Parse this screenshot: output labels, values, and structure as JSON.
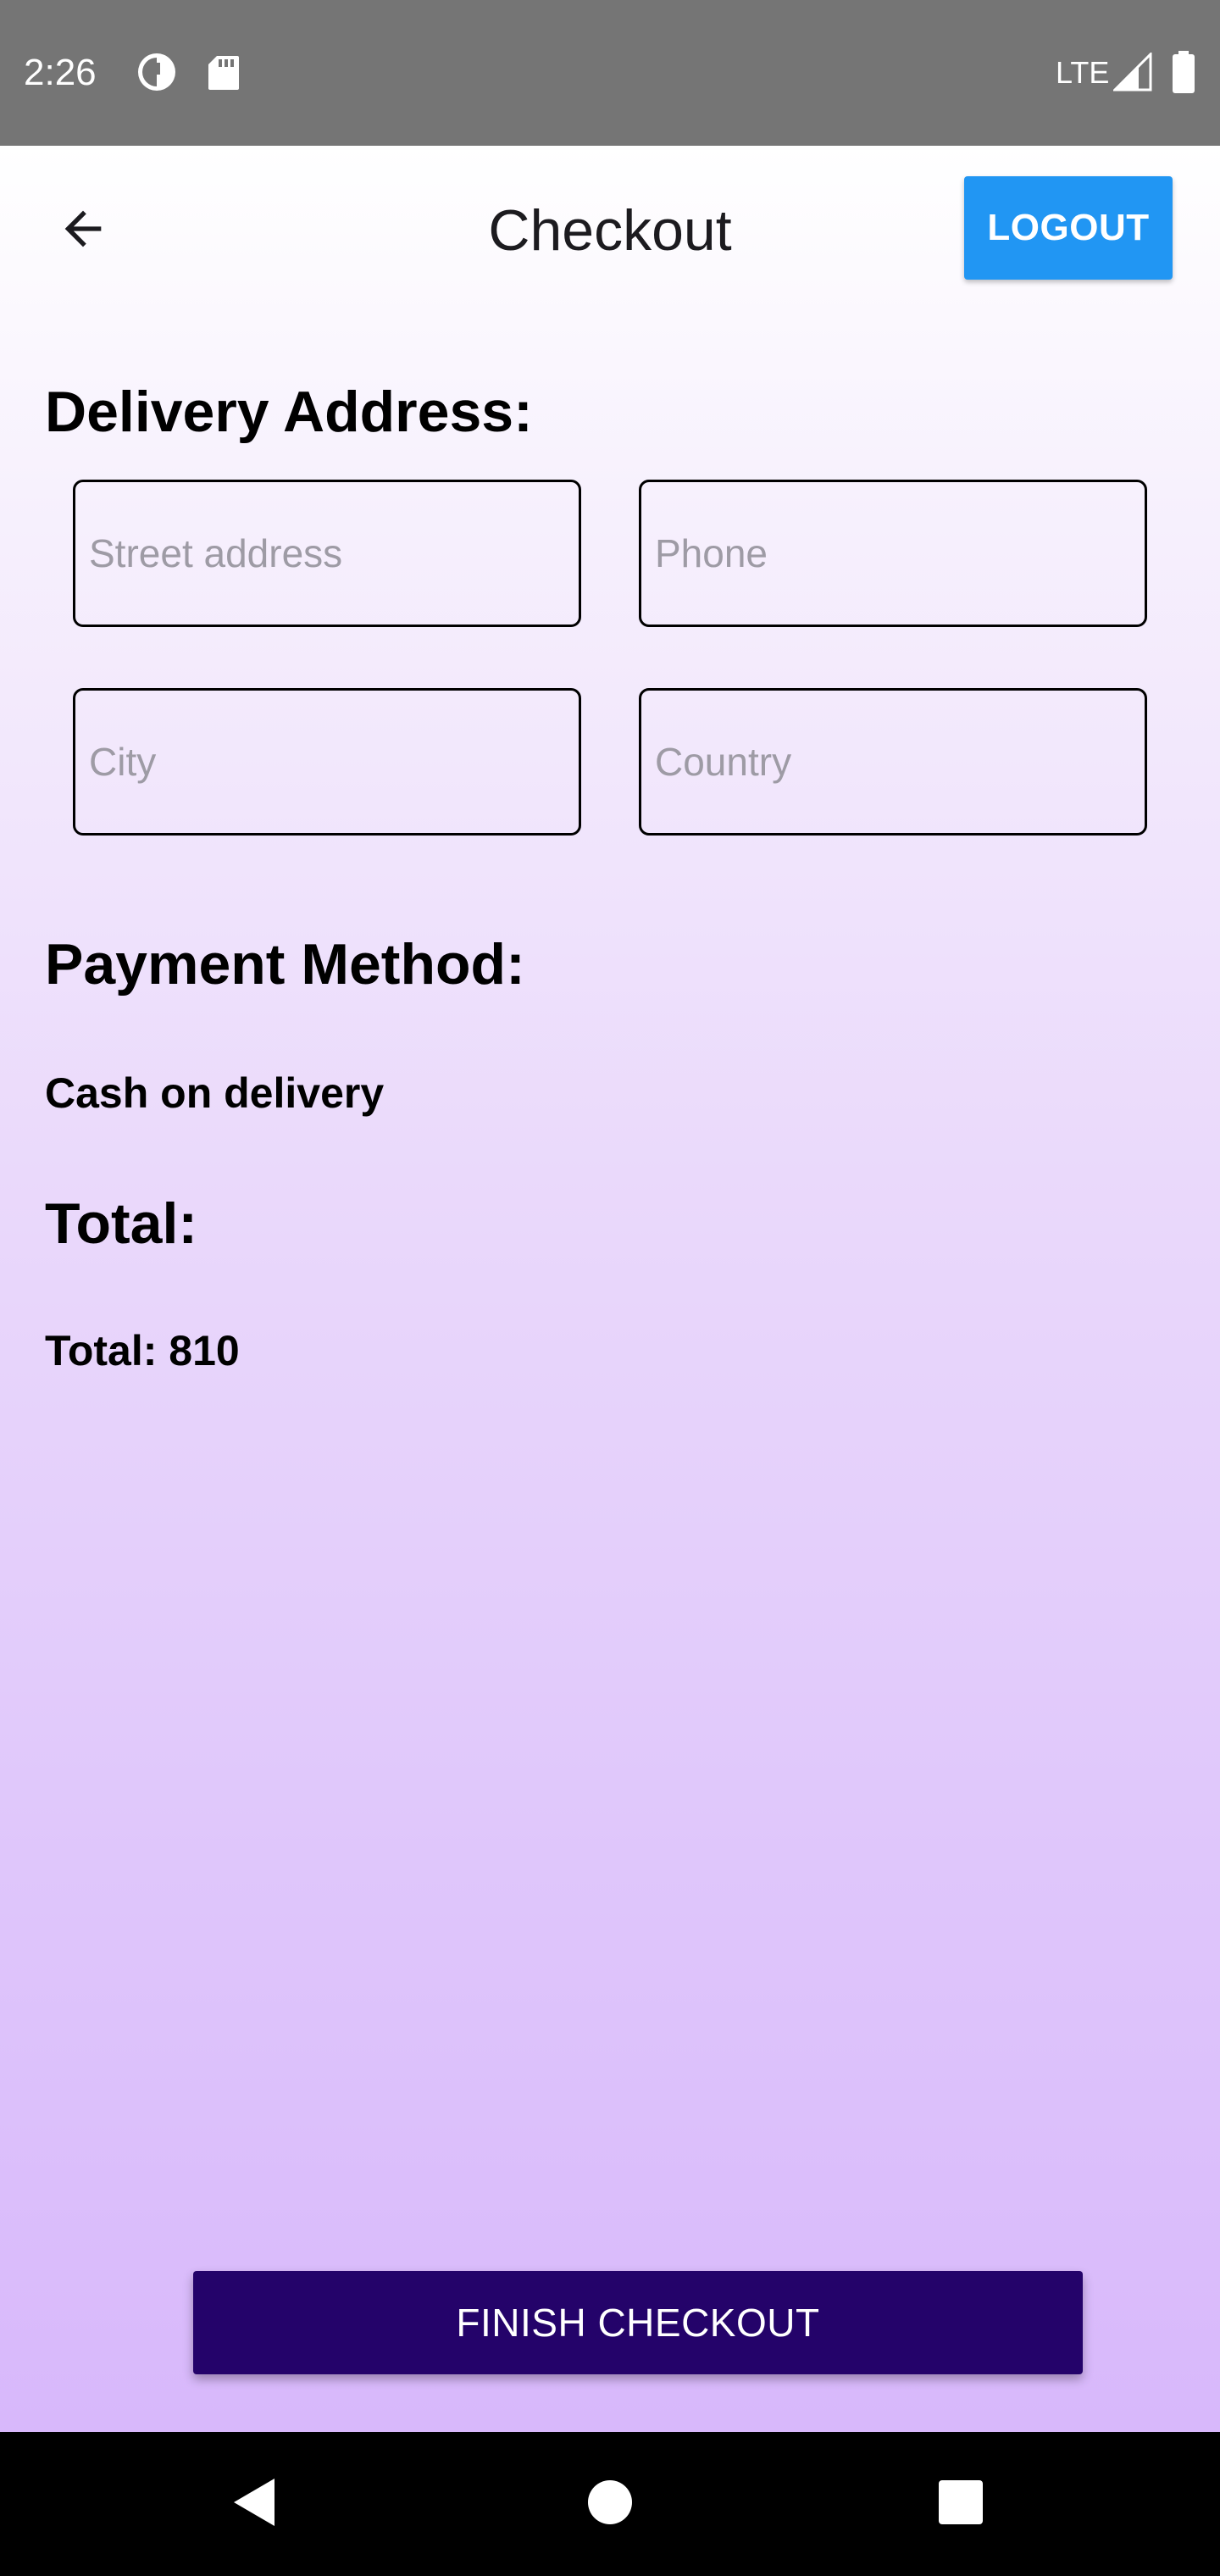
{
  "status_bar": {
    "time": "2:26",
    "network": "LTE",
    "icons": [
      "data-saver-icon",
      "sd-card-icon",
      "signal-icon",
      "battery-icon"
    ]
  },
  "app_bar": {
    "title": "Checkout",
    "back_icon": "arrow-back-icon",
    "logout_label": "LOGOUT"
  },
  "delivery": {
    "heading": "Delivery Address:",
    "street": {
      "placeholder": "Street address",
      "value": ""
    },
    "phone": {
      "placeholder": "Phone",
      "value": ""
    },
    "city": {
      "placeholder": "City",
      "value": ""
    },
    "country": {
      "placeholder": "Country",
      "value": ""
    }
  },
  "payment": {
    "heading": "Payment Method:",
    "method": "Cash on delivery"
  },
  "total": {
    "heading": "Total:",
    "text": "Total: 810"
  },
  "finish_label": "FINISH CHECKOUT",
  "colors": {
    "status_bar": "#757575",
    "logout_button": "#2196f3",
    "finish_button": "#24036a",
    "gradient_top": "#ffffff",
    "gradient_bottom": "#d8b8fb",
    "nav_bar": "#000000"
  },
  "nav_bar": {
    "icons": [
      "back-triangle-icon",
      "home-circle-icon",
      "recents-square-icon"
    ]
  }
}
